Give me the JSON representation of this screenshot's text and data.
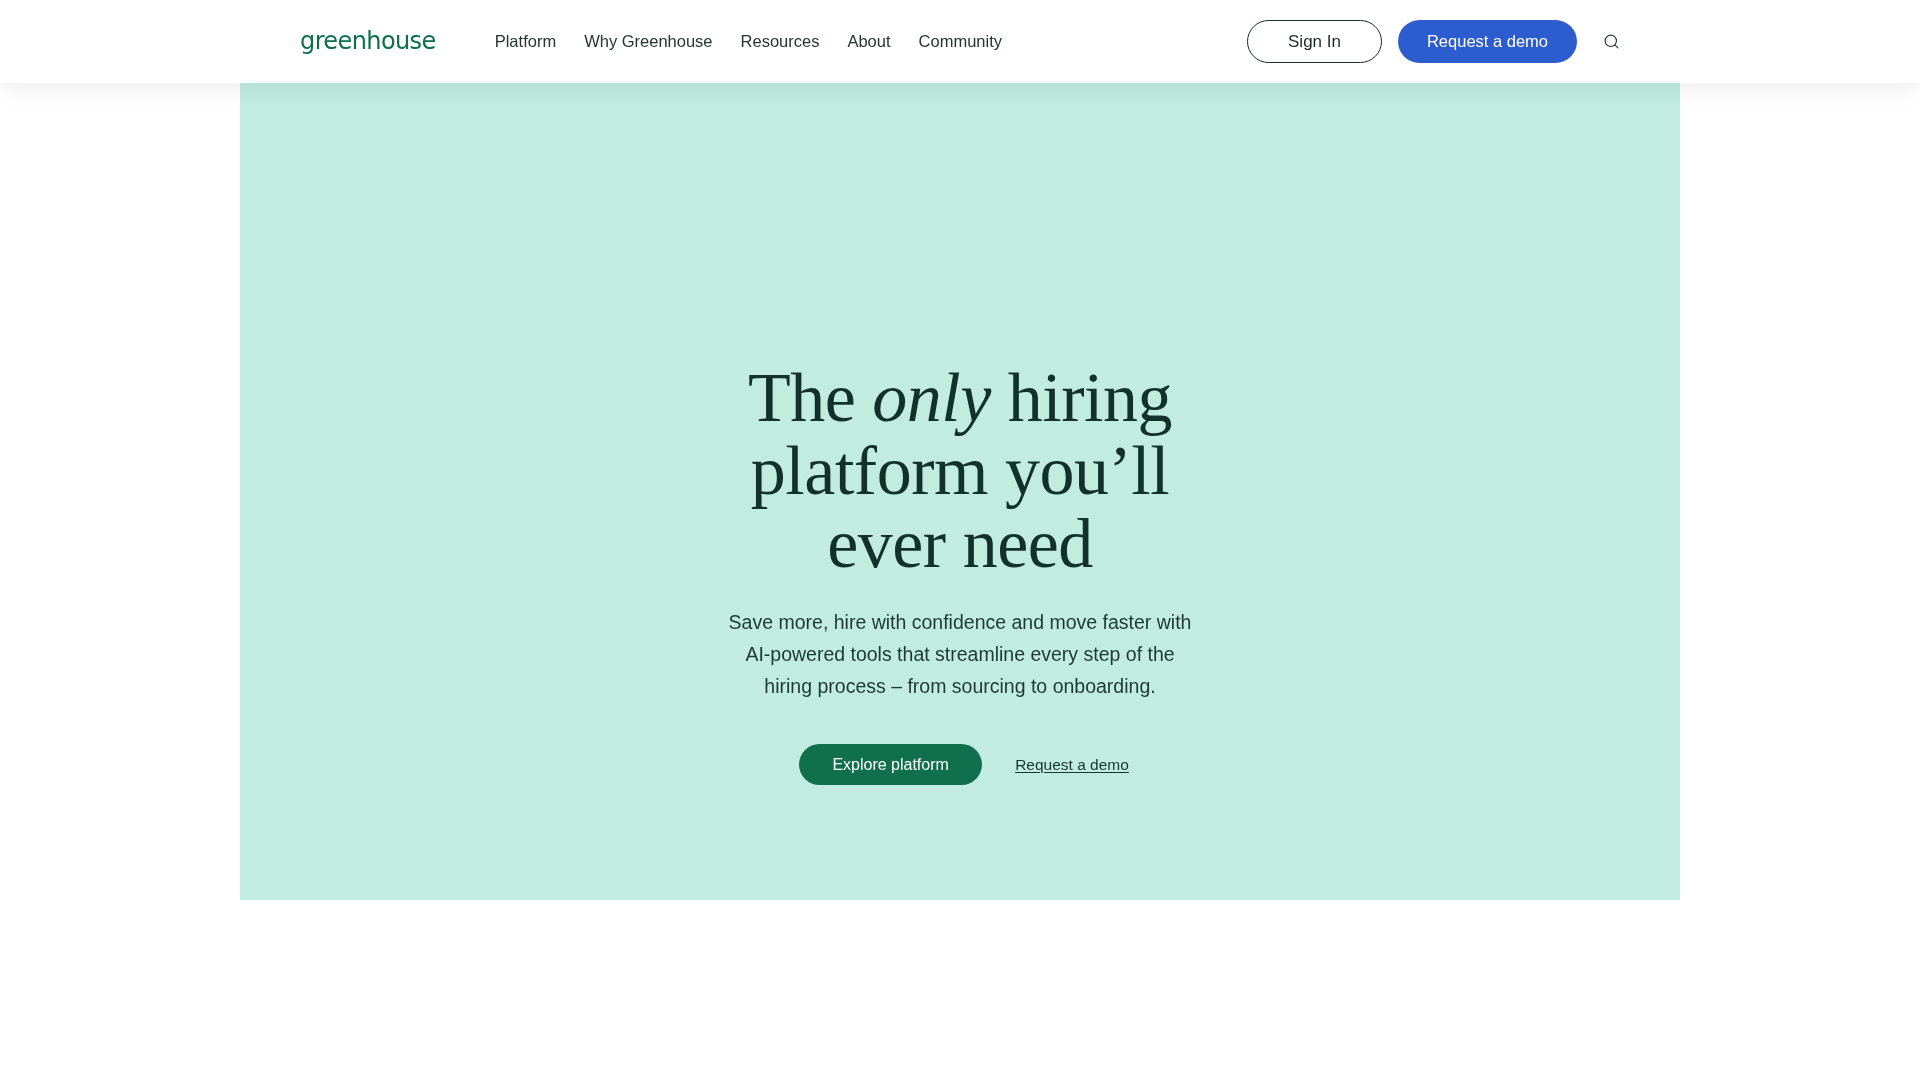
{
  "header": {
    "logo": "greenhouse",
    "nav": [
      {
        "label": "Platform"
      },
      {
        "label": "Why Greenhouse"
      },
      {
        "label": "Resources"
      },
      {
        "label": "About"
      },
      {
        "label": "Community"
      }
    ],
    "sign_in": "Sign In",
    "request_demo": "Request a demo"
  },
  "hero": {
    "headline_lines": [
      "The *only* hiring",
      "platform you’ll",
      "ever need"
    ],
    "subtitle": "Save more, hire with confidence and move faster with AI-powered tools that streamline every step of the hiring process – from sourcing to onboarding.",
    "primary_button": "Explore platform",
    "secondary_link": "Request a demo"
  }
}
